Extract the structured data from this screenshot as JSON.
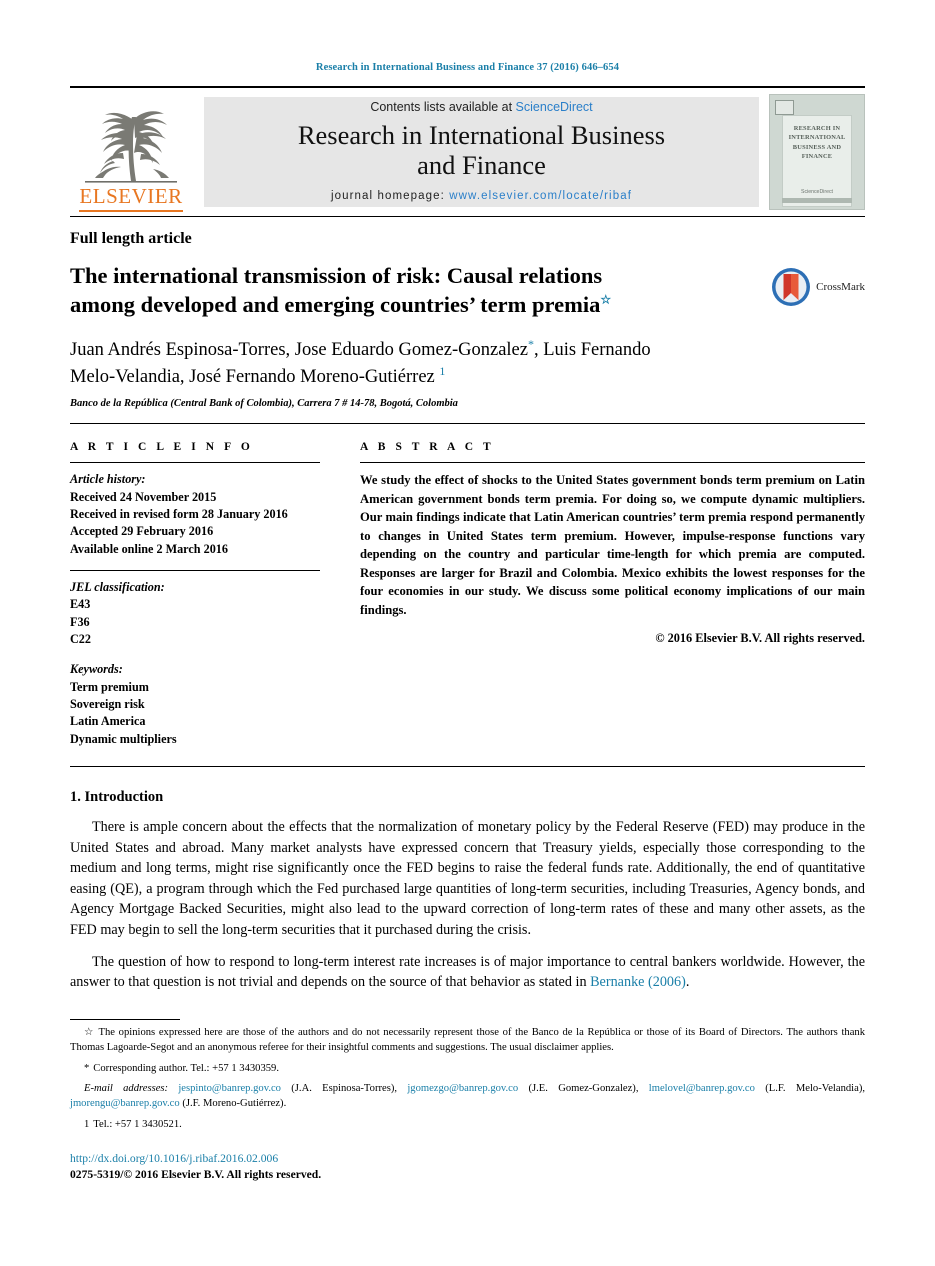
{
  "running_head": "Research in International Business and Finance 37 (2016) 646–654",
  "masthead": {
    "publisher_name": "ELSEVIER",
    "contents_prefix": "Contents lists available at ",
    "contents_link": "ScienceDirect",
    "journal_title_line1": "Research in International Business",
    "journal_title_line2": "and Finance",
    "homepage_prefix": "journal homepage: ",
    "homepage_url": "www.elsevier.com/locate/ribaf",
    "cover": {
      "title_line1": "RESEARCH IN",
      "title_line2": "INTERNATIONAL",
      "title_line3": "BUSINESS AND",
      "title_line4": "FINANCE",
      "sciencedirect_label": "ScienceDirect"
    }
  },
  "article": {
    "type": "Full length article",
    "title_line1": "The international transmission of risk: Causal relations",
    "title_line2": "among developed and emerging countries’ term premia",
    "title_footnote_mark": "☆",
    "crossmark_label": "CrossMark",
    "authors_line1": "Juan Andrés Espinosa-Torres, Jose Eduardo Gomez-Gonzalez",
    "authors_line1_mark": "*",
    "authors_line1_cont": ", Luis Fernando",
    "authors_line2": "Melo-Velandia, José Fernando Moreno-Gutiérrez",
    "authors_line2_mark": "1",
    "affiliation": "Banco de la República (Central Bank of Colombia), Carrera 7 # 14-78, Bogotá, Colombia"
  },
  "article_info": {
    "heading": "A R T I C L E   I N F O",
    "history_label": "Article history:",
    "history": [
      "Received 24 November 2015",
      "Received in revised form 28 January 2016",
      "Accepted 29 February 2016",
      "Available online 2 March 2016"
    ],
    "jel_label": "JEL classification:",
    "jel_codes": [
      "E43",
      "F36",
      "C22"
    ],
    "keywords_label": "Keywords:",
    "keywords": [
      "Term premium",
      "Sovereign risk",
      "Latin America",
      "Dynamic multipliers"
    ]
  },
  "abstract": {
    "heading": "A B S T R A C T",
    "text": "We study the effect of shocks to the United States government bonds term premium on Latin American government bonds term premia. For doing so, we compute dynamic multipliers. Our main findings indicate that Latin American countries’ term premia respond permanently to changes in United States term premium. However, impulse-response functions vary depending on the country and particular time-length for which premia are computed. Responses are larger for Brazil and Colombia. Mexico exhibits the lowest responses for the four economies in our study. We discuss some political economy implications of our main findings.",
    "copyright": "© 2016 Elsevier B.V. All rights reserved."
  },
  "body": {
    "section_title": "1. Introduction",
    "paragraph1": "There is ample concern about the effects that the normalization of monetary policy by the Federal Reserve (FED) may produce in the United States and abroad. Many market analysts have expressed concern that Treasury yields, especially those corresponding to the medium and long terms, might rise significantly once the FED begins to raise the federal funds rate. Additionally, the end of quantitative easing (QE), a program through which the Fed purchased large quantities of long-term securities, including Treasuries, Agency bonds, and Agency Mortgage Backed Securities, might also lead to the upward correction of long-term rates of these and many other assets, as the FED may begin to sell the long-term securities that it purchased during the crisis.",
    "paragraph2_pre": "The question of how to respond to long-term interest rate increases is of major importance to central bankers worldwide. However, the answer to that question is not trivial and depends on the source of that behavior as stated in ",
    "paragraph2_cite": "Bernanke (2006)",
    "paragraph2_post": "."
  },
  "footnotes": {
    "star_mark": "☆",
    "star_text": "The opinions expressed here are those of the authors and do not necessarily represent those of the Banco de la República or those of its Board of Directors. The authors thank Thomas Lagoarde-Segot and an anonymous referee for their insightful comments and suggestions. The usual disclaimer applies.",
    "corresponding_mark": "*",
    "corresponding_text": "Corresponding author. Tel.: +57 1 3430359.",
    "email_label": "E-mail addresses:",
    "emails": [
      {
        "address": "jespinto@banrep.gov.co",
        "owner": "(J.A. Espinosa-Torres),"
      },
      {
        "address": "jgomezgo@banrep.gov.co",
        "owner": "(J.E. Gomez-Gonzalez),"
      },
      {
        "address": "lmelovel@banrep.gov.co",
        "owner": "(L.F. Melo-Velandia),"
      },
      {
        "address": "jmorengu@banrep.gov.co",
        "owner": "(J.F. Moreno-Gutiérrez)."
      }
    ],
    "note1_mark": "1",
    "note1_text": "Tel.: +57 1 3430521."
  },
  "footer": {
    "doi": "http://dx.doi.org/10.1016/j.ribaf.2016.02.006",
    "issn": "0275-5319/© 2016 Elsevier B.V. All rights reserved."
  },
  "colors": {
    "link_blue": "#1a7fa8",
    "sd_blue": "#2a7fc9",
    "elsevier_orange": "#E87722"
  }
}
